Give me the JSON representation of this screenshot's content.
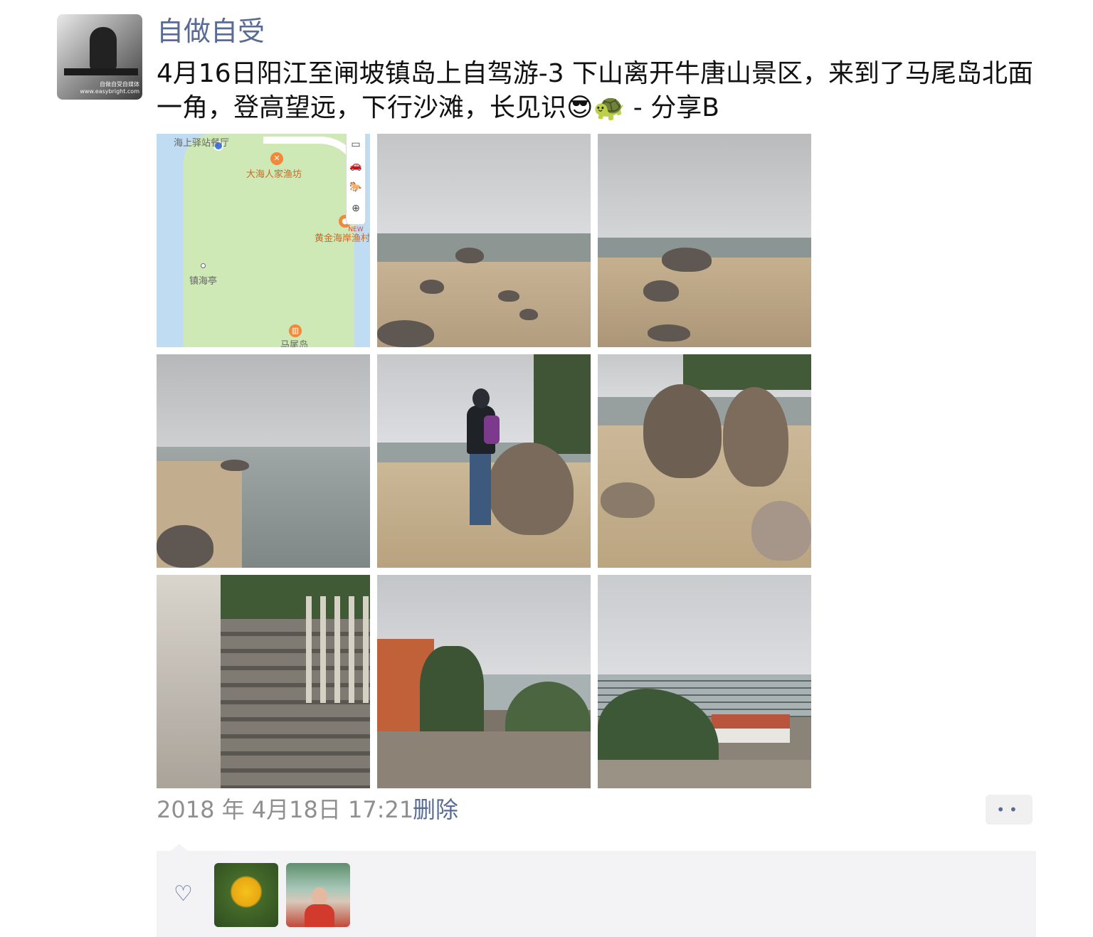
{
  "author": {
    "name": "自做自受",
    "avatar_caption": "自做自受自媒体\nwww.easybright.com"
  },
  "post": {
    "text": "4月16日阳江至闸坡镇岛上自驾游-3 下山离开牛唐山景区，来到了马尾岛北面一角，登高望远，下行沙滩，长见识😎🐢 - 分享B"
  },
  "map": {
    "labels": {
      "restaurant": "海上驿站餐厅",
      "fishery": "大海人家渔坊",
      "coast": "黄金海岸渔村",
      "pavilion": "镇海亭",
      "island": "马尾岛"
    },
    "controls": [
      "▭",
      "🚗",
      "🐎",
      "⊕",
      "NEW"
    ]
  },
  "photos": [
    {
      "name": "beach-rocks"
    },
    {
      "name": "beach-rocks-wide"
    },
    {
      "name": "shoreline"
    },
    {
      "name": "person-photographing"
    },
    {
      "name": "large-boulders"
    },
    {
      "name": "stone-stairs"
    },
    {
      "name": "hilltop-view"
    },
    {
      "name": "harbor-view"
    }
  ],
  "footer": {
    "timestamp": "2018 年 4月18日 17:21",
    "delete_label": "删除",
    "more_label": "••"
  },
  "likes": {
    "heart": "♡"
  },
  "colors": {
    "link": "#576b95",
    "meta": "#8f8f8f",
    "like_bg": "#f3f3f5"
  }
}
